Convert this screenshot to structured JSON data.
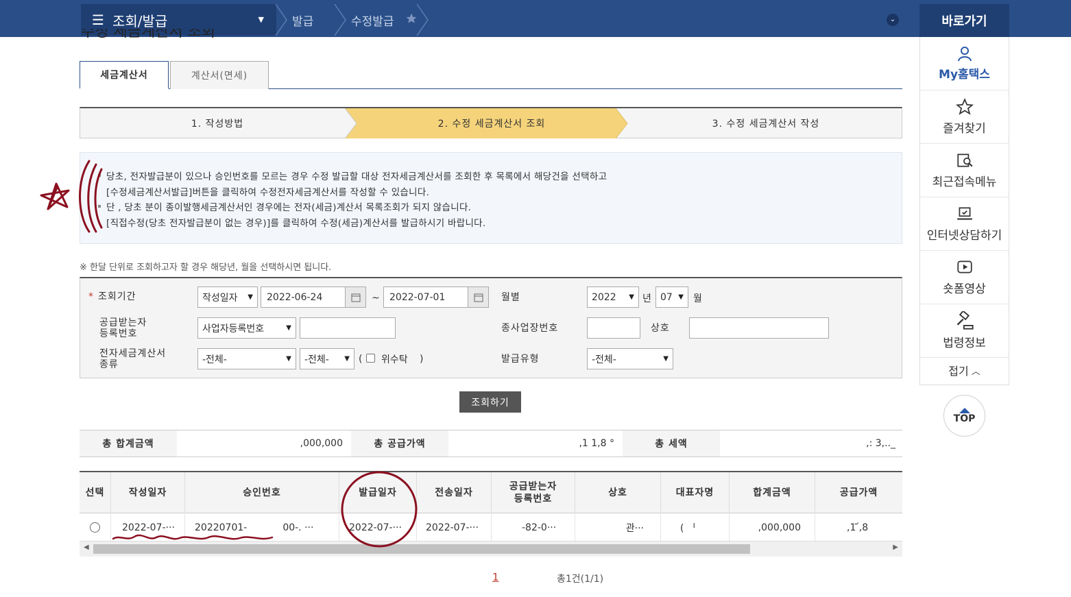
{
  "nav": {
    "menu_label": "조회/발급",
    "crumbs": [
      "발급",
      "수정발급"
    ]
  },
  "sidebar": {
    "title": "바로가기",
    "items": [
      {
        "label": "My홈택스"
      },
      {
        "label": "즐겨찾기"
      },
      {
        "label": "최근접속메뉴"
      },
      {
        "label": "인터넷상담하기"
      },
      {
        "label": "숏폼영상"
      },
      {
        "label": "법령정보"
      }
    ],
    "fold_label": "접기",
    "top_label": "TOP"
  },
  "page": {
    "title": "수정 세금계산서 조회"
  },
  "tabs": [
    {
      "label": "세금계산서",
      "active": true
    },
    {
      "label": "계산서(면세)",
      "active": false
    }
  ],
  "steps": [
    {
      "label": "1. 작성방법"
    },
    {
      "label": "2. 수정 세금계산서 조회"
    },
    {
      "label": "3. 수정 세금계산서 작성"
    }
  ],
  "notice": {
    "lines": [
      "당초, 전자발급분이 있으나 승인번호를 모르는 경우 수정 발급할 대상 전자세금계산서를 조회한 후 목록에서 해당건을 선택하고",
      "[수정세금계산서발급]버튼을 클릭하여 수정전자세금계산서를 작성할 수 있습니다.",
      "단 , 당초 분이 종이발행세금계산서인 경우에는 전자(세금)계산서 목록조회가 되지 않습니다.",
      "[직접수정(당초 전자발급분이 없는 경우)]를 클릭하여 수정(세금)계산서를 발급하시기 바랍니다."
    ]
  },
  "hint": "※ 한달 단위로 조회하고자 할 경우 해당년, 월을 선택하시면 됩니다.",
  "form": {
    "period_label": "조회기간",
    "period_type": "작성일자",
    "date_from": "2022-06-24",
    "date_sep": "~",
    "date_to": "2022-07-01",
    "monthly_label": "월별",
    "year": "2022",
    "year_unit": "년",
    "month": "07",
    "month_unit": "월",
    "buyer_reg_label_1": "공급받는자",
    "buyer_reg_label_2": "등록번호",
    "buyer_reg_type": "사업자등록번호",
    "buyer_reg_value": "",
    "branch_label": "종사업장번호",
    "branch_value": "",
    "company_label": "상호",
    "company_value": "",
    "kind_label_1": "전자세금계산서",
    "kind_label_2": "종류",
    "kind_1": "-전체-",
    "kind_2": "-전체-",
    "consign_open": "(",
    "consign_label": "위수탁",
    "consign_close": ")",
    "issue_type_label": "발급유형",
    "issue_type": "-전체-",
    "search_button": "조회하기"
  },
  "totals": [
    {
      "label": "총 합계금액",
      "value": ",000,000"
    },
    {
      "label": "총 공급가액",
      "value": ",1  1,8  °"
    },
    {
      "label": "총 세액",
      "value": ",:  3,.._"
    }
  ],
  "table": {
    "headers": [
      "선택",
      "작성일자",
      "승인번호",
      "발급일자",
      "전송일자",
      "공급받는자\n등록번호",
      "상호",
      "대표자명",
      "합계금액",
      "공급가액"
    ],
    "header_buyer_1": "공급받는자",
    "header_buyer_2": "등록번호",
    "rows": [
      {
        "write_date": "2022-07-···",
        "approval_no": "20220701-",
        "approval_no_tail": "00-.    ···",
        "issue_date": "2022-07-···",
        "send_date": "2022-07-···",
        "buyer_reg": "-82-0···",
        "company": "관···",
        "ceo": "(        ᅵ",
        "total": ",000,000",
        "supply": ",1   ᷄,8"
      }
    ]
  },
  "pager": {
    "current": "1",
    "total": "총1건(1/1)"
  }
}
